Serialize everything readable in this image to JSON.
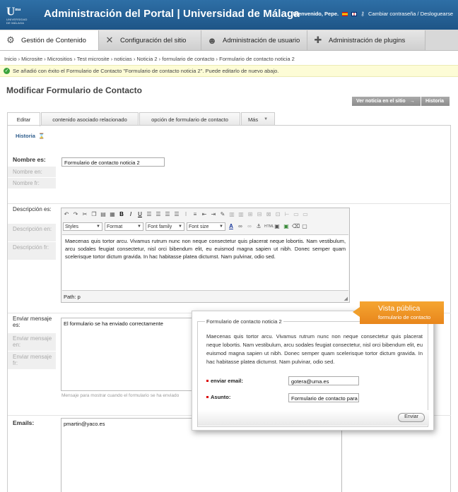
{
  "header": {
    "logo_mark": "U",
    "logo_sup": "ma",
    "logo_sub": "UNIVERSIDAD DE MÁLAGA",
    "title": "Administración del Portal | Universidad de Málaga",
    "welcome": "Bienvenido, Pepe.",
    "account_link": "Cambiar contraseña / Desloguearse"
  },
  "main_tabs": [
    {
      "label": "Gestión de Contenido",
      "icon": "gear-icon"
    },
    {
      "label": "Configuración del sitio",
      "icon": "wrench-icon"
    },
    {
      "label": "Administración de usuario",
      "icon": "user-icon"
    },
    {
      "label": "Administración de plugins",
      "icon": "plugin-icon"
    }
  ],
  "breadcrumb": "Inicio › Microsite › Micrositios › Test microsite › noticias › Noticia 2 › formulario de contacto › Formulario de contacto noticia 2",
  "success_message": "Se añadió con éxito el Formulario de Contacto \"Formulario de contacto noticia 2\". Puede editarlo de nuevo abajo.",
  "page_title": "Modificar Formulario de Contacto",
  "actions": {
    "view_public": "Ver noticia en el sitio",
    "history": "Historia"
  },
  "form_tabs": [
    "Editar",
    "contenido asociado relacionado",
    "opción de formulario de contacto",
    "Más"
  ],
  "history_link": "Historia",
  "fields": {
    "name_label": "Nombre es:",
    "name_value": "Formulario de contacto noticia 2",
    "name_en": "Nombre en:",
    "name_fr": "Nombre fr:",
    "desc_label": "Descripción es:",
    "desc_en": "Descripción en:",
    "desc_fr": "Descripción fr:",
    "msg_label": "Enviar mensaje es:",
    "msg_en": "Enviar mensaje en:",
    "msg_fr": "Enviar mensaje fr:",
    "msg_value": "El formulario se ha enviado correctamente",
    "msg_hint": "Mensaje para mostrar cuando el formulario se ha enviado",
    "emails_label": "Emails:",
    "emails_value": "pmartin@yaco.es"
  },
  "editor": {
    "styles": "Styles",
    "format": "Format",
    "font_family": "Font family",
    "font_size": "Font size",
    "content": "Maecenas quis tortor arcu. Vivamus rutrum nunc non neque consectetur quis placerat neque lobortis. Nam vestibulum, arcu sodales feugiat consectetur, nisl orci bibendum elit, eu euismod magna sapien ut nibh. Donec semper quam scelerisque tortor dictum gravida. In hac habitasse platea dictumst. Nam pulvinar, odio sed.",
    "path": "Path: p"
  },
  "popup": {
    "legend": "Formulario de contacto noticia 2",
    "body": "Maecenas quis tortor arcu. Vivamus rutrum nunc non neque consectetur quis placerat neque lobortis. Nam vestibulum, arcu sodales feugiat consectetur, nisl orci bibendum elit, eu euismod magna sapien ut nibh. Donec semper quam scelerisque tortor dictum gravida. In hac habitasse platea dictumst. Nam pulvinar, odio sed.",
    "email_label": "enviar email:",
    "email_value": "gotera@uma.es",
    "subject_label": "Asunto:",
    "subject_value": "Formulario de contacto para",
    "send": "Enviar"
  },
  "callout": {
    "title": "Vista pública",
    "subtitle": "formulario de contacto"
  },
  "colors": {
    "header": "#1e5587",
    "callout": "#f09f2c",
    "success_bg": "#fdfcd6"
  }
}
